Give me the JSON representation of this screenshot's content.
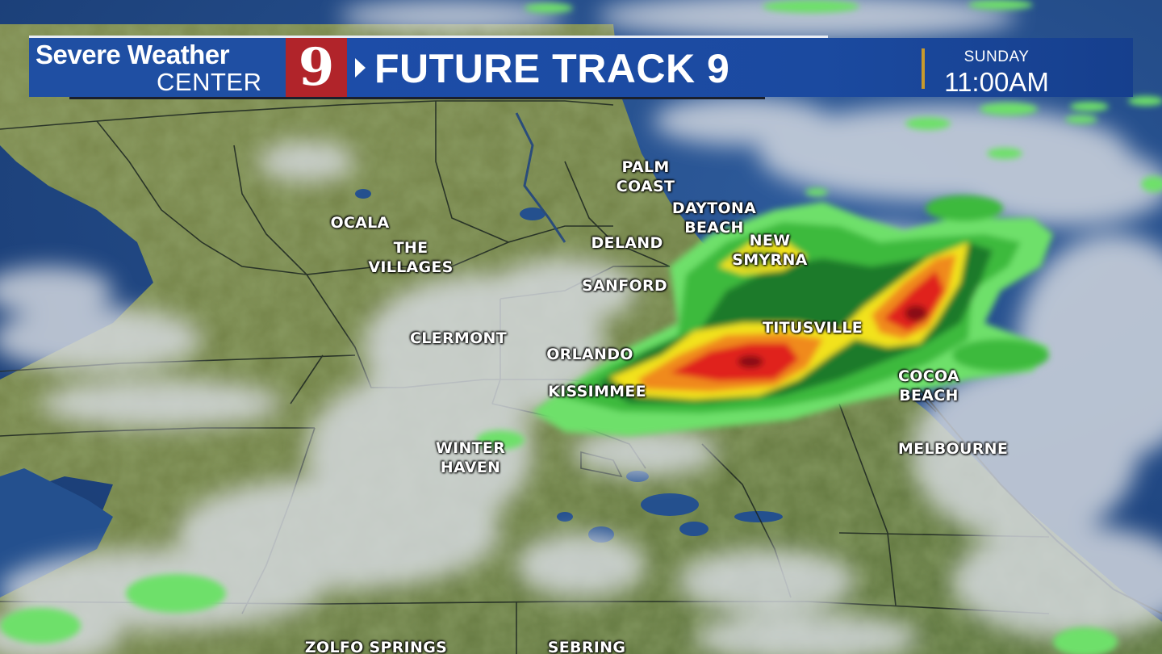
{
  "banner": {
    "logo_line1": "Severe Weather",
    "logo_line2": "CENTER",
    "logo_number": "9",
    "title": "FUTURE TRACK 9",
    "day": "SUNDAY",
    "time": "11:00AM"
  },
  "colors": {
    "banner_blue": "#1d4da8",
    "logo_red": "#b1242a",
    "divider_gold": "#c89a2c",
    "water": "#1f4b8c",
    "radar_light_green": "#6ee06a",
    "radar_dark_green": "#1f7a2a",
    "radar_yellow": "#f2e21a",
    "radar_orange": "#f08a1a",
    "radar_red": "#e0201a",
    "radar_dark_red": "#8a0d12"
  },
  "cities": [
    {
      "id": "palm-coast",
      "lines": [
        "PALM",
        "COAST"
      ]
    },
    {
      "id": "daytona-beach",
      "lines": [
        "DAYTONA",
        "BEACH"
      ]
    },
    {
      "id": "ocala",
      "lines": [
        "OCALA"
      ]
    },
    {
      "id": "the-villages",
      "lines": [
        "THE",
        "VILLAGES"
      ]
    },
    {
      "id": "deland",
      "lines": [
        "DELAND"
      ]
    },
    {
      "id": "new-smyrna",
      "lines": [
        "NEW",
        "SMYRNA"
      ]
    },
    {
      "id": "sanford",
      "lines": [
        "SANFORD"
      ]
    },
    {
      "id": "titusville",
      "lines": [
        "TITUSVILLE"
      ]
    },
    {
      "id": "clermont",
      "lines": [
        "CLERMONT"
      ]
    },
    {
      "id": "orlando",
      "lines": [
        "ORLANDO"
      ]
    },
    {
      "id": "cocoa-beach",
      "lines": [
        "COCOA",
        "BEACH"
      ]
    },
    {
      "id": "kissimmee",
      "lines": [
        "KISSIMMEE"
      ]
    },
    {
      "id": "winter-haven",
      "lines": [
        "WINTER",
        "HAVEN"
      ]
    },
    {
      "id": "melbourne",
      "lines": [
        "MELBOURNE"
      ]
    },
    {
      "id": "zolfo-springs",
      "lines": [
        "ZOLFO SPRINGS"
      ]
    },
    {
      "id": "sebring",
      "lines": [
        "SEBRING"
      ]
    }
  ]
}
